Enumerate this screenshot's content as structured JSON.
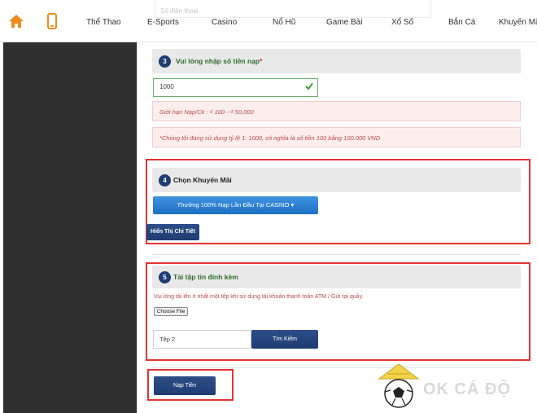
{
  "nav": {
    "ghost_text": "Số điện thoại",
    "items": [
      "Thể Thao",
      "E-Sports",
      "Casino",
      "Nổ Hũ",
      "Game Bài",
      "Xổ Số",
      "Bắn Cá",
      "Khuyến Mãi"
    ]
  },
  "step3": {
    "number": "3",
    "title": "Vui lòng nhập số tiền nạp",
    "required_mark": "*",
    "amount_value": "1000",
    "limit_text": "Giới hạn Nạp/Ck : ₫ 100 - ₫ 50,000",
    "rate_text": "*Chúng tôi đang sử dụng tỷ lệ 1: 1000, có nghĩa là số tiền 100 bằng 100.000 VND"
  },
  "step4": {
    "number": "4",
    "title": "Chọn Khuyến Mãi",
    "promo_selected": "Thưởng 100% Nạp Lần Đầu Tại CASINO ▾",
    "detail_button": "Hiển Thị Chi Tiết"
  },
  "step5": {
    "number": "5",
    "title": "Tải tập tin đính kèm",
    "note": "Vui lòng tải lên ít nhất một tệp khi sử dụng tài khoản thanh toán ATM / Gửi tại quầy.",
    "choose_file": "Choose File",
    "file_field_value": "Tệp 2",
    "browse_button": "Tìm Kiếm"
  },
  "submit_button": "Nạp Tiền",
  "logo": {
    "text": "OK CÁ ĐỘ"
  },
  "colors": {
    "navy": "#1f3c73",
    "blue": "#2a7fd4",
    "red_outline": "#e53333",
    "orange": "#f08a1c",
    "sidebar": "#2f2f2f"
  }
}
